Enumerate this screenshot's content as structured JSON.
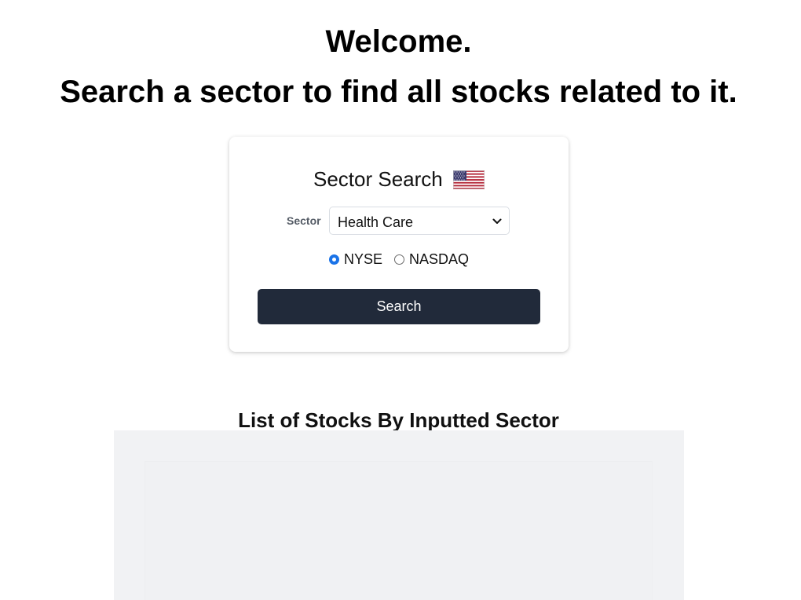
{
  "header": {
    "welcome": "Welcome.",
    "subtitle": "Search a sector to find all stocks related to it."
  },
  "search_card": {
    "title": "Sector Search",
    "flag_icon": "us-flag-icon",
    "sector_label": "Sector",
    "sector_selected": "Health Care",
    "exchanges": [
      {
        "label": "NYSE",
        "selected": true
      },
      {
        "label": "NASDAQ",
        "selected": false
      }
    ],
    "search_button_label": "Search",
    "button_color": "#212a3a"
  },
  "results": {
    "title": "List of Stocks By Inputted Sector"
  },
  "colors": {
    "accent_radio": "#1a73e8",
    "results_bg": "#f1f2f4"
  }
}
